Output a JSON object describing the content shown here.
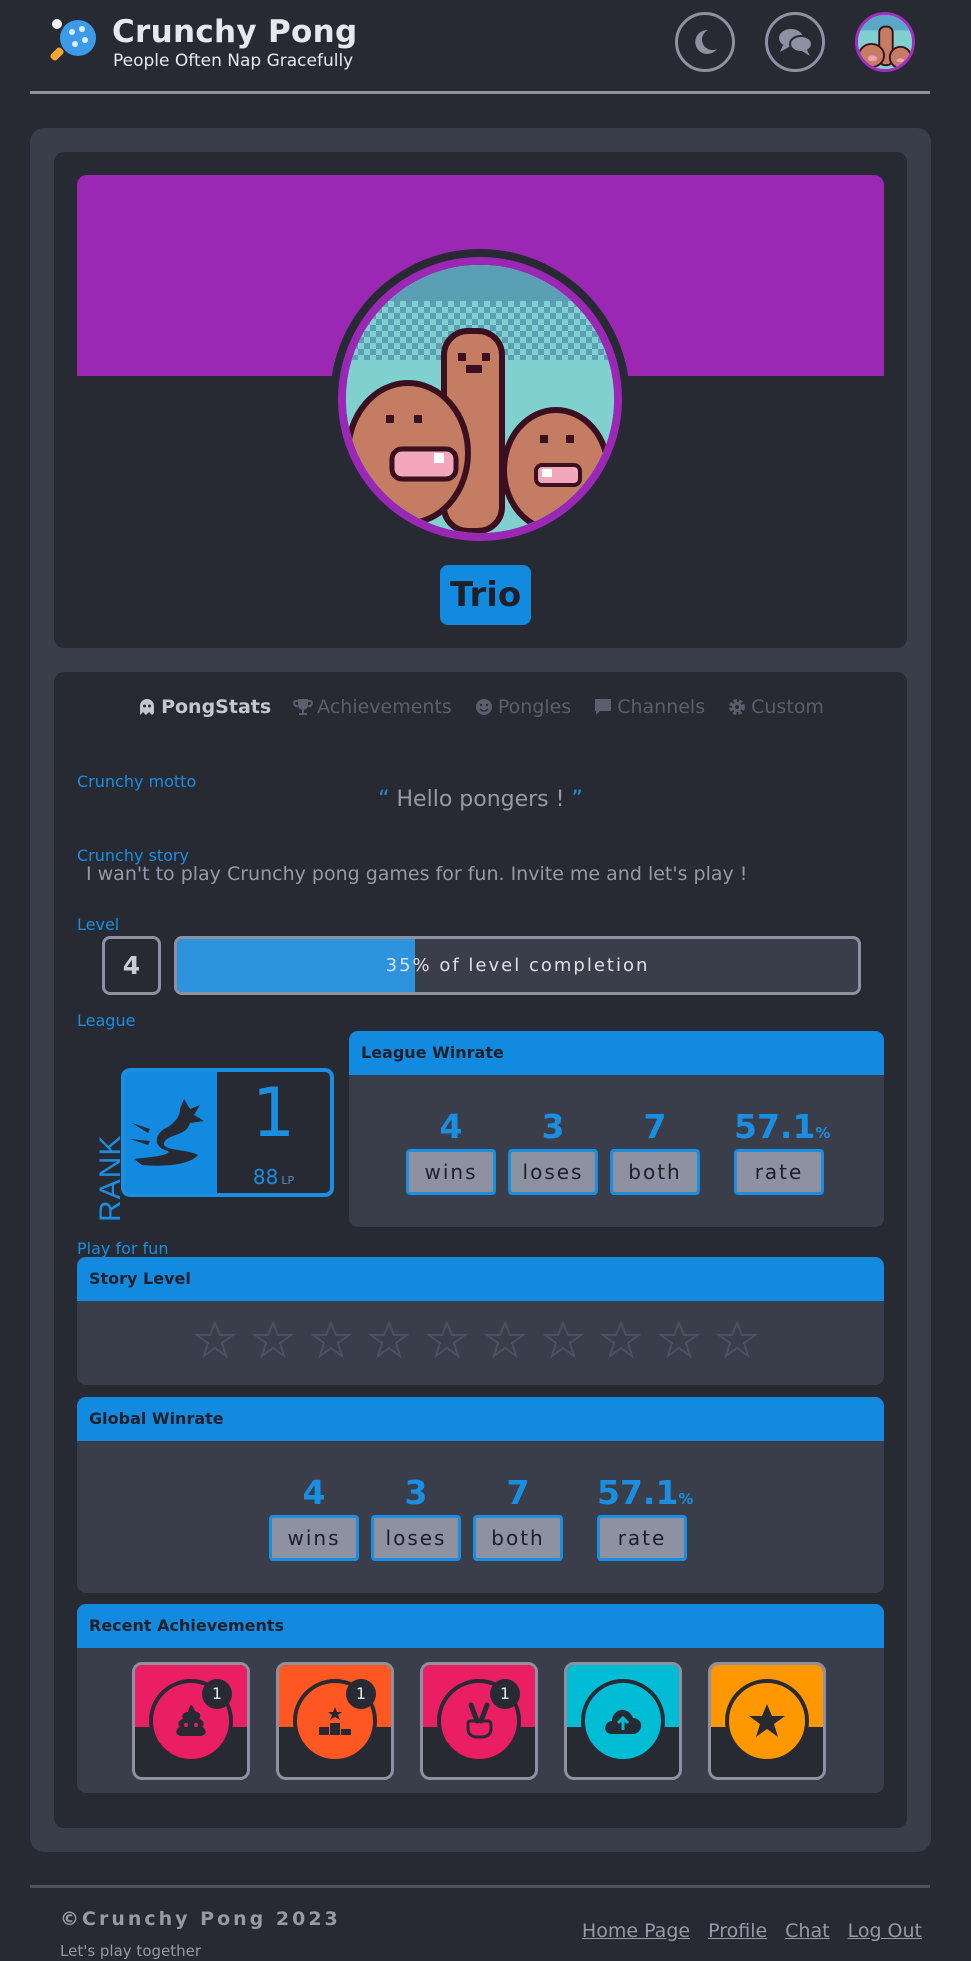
{
  "header": {
    "title": "Crunchy Pong",
    "subtitle": "People Often Nap Gracefully",
    "icons": [
      "ping-pong-logo-icon",
      "moon-icon",
      "chat-bubbles-icon",
      "user-avatar"
    ]
  },
  "profile": {
    "username": "Trio",
    "banner_color": "#9b28b5"
  },
  "tabs": [
    {
      "label": "PongStats",
      "icon": "ghost-icon",
      "active": true
    },
    {
      "label": "Achievements",
      "icon": "trophy-icon",
      "active": false
    },
    {
      "label": "Pongles",
      "icon": "smile-icon",
      "active": false
    },
    {
      "label": "Channels",
      "icon": "message-icon",
      "active": false
    },
    {
      "label": "Custom",
      "icon": "gear-icon",
      "active": false
    }
  ],
  "motto": {
    "label": "Crunchy motto",
    "open_quote": "“",
    "text": "Hello pongers !",
    "close_quote": "”"
  },
  "story": {
    "label": "Crunchy story",
    "text": "I wan't to play Crunchy pong games for fun. Invite me and let's play !"
  },
  "level": {
    "label": "Level",
    "value": "4",
    "progress_percent": 35,
    "progress_text": "35% of level completion"
  },
  "league": {
    "label": "League",
    "rank_label": "RANK",
    "rank": "1",
    "lp": "88",
    "lp_unit": "LP",
    "winrate": {
      "title": "League Winrate",
      "stats": [
        {
          "value": "4",
          "label": "wins"
        },
        {
          "value": "3",
          "label": "loses"
        },
        {
          "value": "7",
          "label": "both"
        },
        {
          "value": "57.1",
          "unit": "%",
          "label": "rate"
        }
      ]
    }
  },
  "fun": {
    "label": "Play for fun",
    "story_level": {
      "title": "Story Level",
      "stars_total": 10,
      "stars_filled": 0
    },
    "global_winrate": {
      "title": "Global Winrate",
      "stats": [
        {
          "value": "4",
          "label": "wins"
        },
        {
          "value": "3",
          "label": "loses"
        },
        {
          "value": "7",
          "label": "both"
        },
        {
          "value": "57.1",
          "unit": "%",
          "label": "rate"
        }
      ]
    }
  },
  "recent_achievements": {
    "title": "Recent Achievements",
    "items": [
      {
        "icon": "poop-icon",
        "color": "#e91e63",
        "count": "1"
      },
      {
        "icon": "podium-icon",
        "color": "#ff5722",
        "count": "1"
      },
      {
        "icon": "peace-hand-icon",
        "color": "#e91e63",
        "count": "1"
      },
      {
        "icon": "cloud-upload-icon",
        "color": "#00bcd4",
        "count": ""
      },
      {
        "icon": "star-icon",
        "color": "#ff9800",
        "count": ""
      }
    ]
  },
  "footer": {
    "copyright": "©Crunchy Pong 2023",
    "tagline": "Let's play together",
    "links": [
      "Home Page",
      "Profile",
      "Chat",
      "Log Out"
    ]
  }
}
